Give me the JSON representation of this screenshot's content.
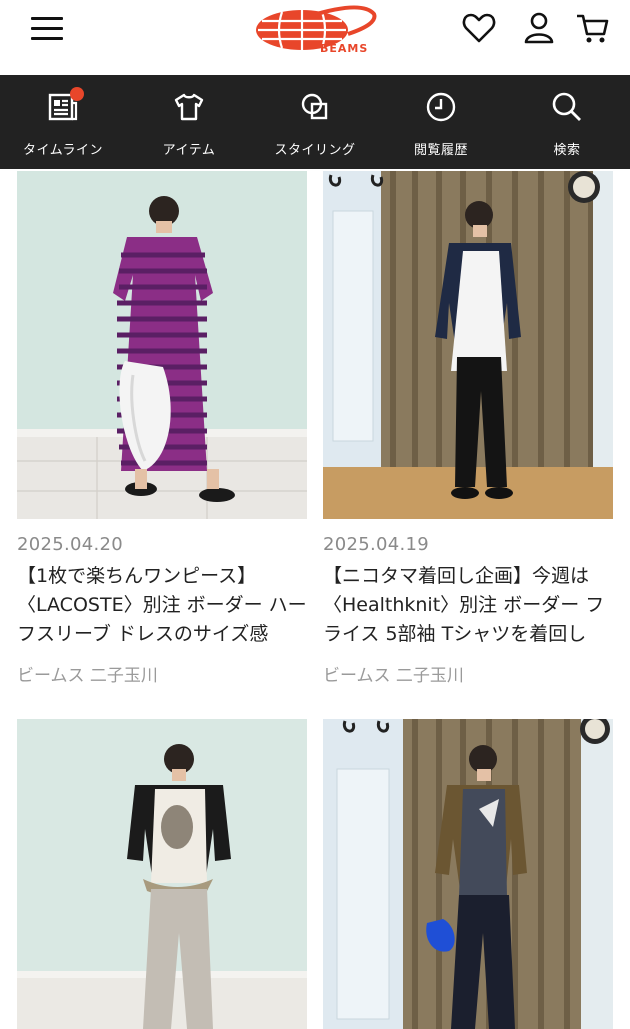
{
  "header": {
    "menu_icon": "hamburger-menu-icon",
    "logo_text": "BEAMS",
    "icons": [
      "heart-icon",
      "user-icon",
      "cart-icon"
    ],
    "brand_color": "#e8462a"
  },
  "nav": {
    "items": [
      {
        "label": "タイムライン",
        "icon": "timeline-news-icon",
        "badge": true
      },
      {
        "label": "アイテム",
        "icon": "tshirt-icon",
        "badge": false
      },
      {
        "label": "スタイリング",
        "icon": "styling-icon",
        "badge": false
      },
      {
        "label": "閲覧履歴",
        "icon": "clock-history-icon",
        "badge": false
      },
      {
        "label": "検索",
        "icon": "search-icon",
        "badge": false
      }
    ],
    "background": "#222222"
  },
  "posts": [
    {
      "date": "2025.04.20",
      "title": "【1枚で楽ちんワンピース】〈LACOSTE〉別注 ボーダー ハーフスリーブ ドレスのサイズ感",
      "shop": "ビームス 二子玉川"
    },
    {
      "date": "2025.04.19",
      "title": "【ニコタマ着回し企画】今週は〈Healthknit〉別注 ボーダー フライス 5部袖 Tシャツを着回し",
      "shop": "ビームス 二子玉川"
    },
    {
      "date": "",
      "title": "",
      "shop": ""
    },
    {
      "date": "",
      "title": "",
      "shop": ""
    }
  ]
}
